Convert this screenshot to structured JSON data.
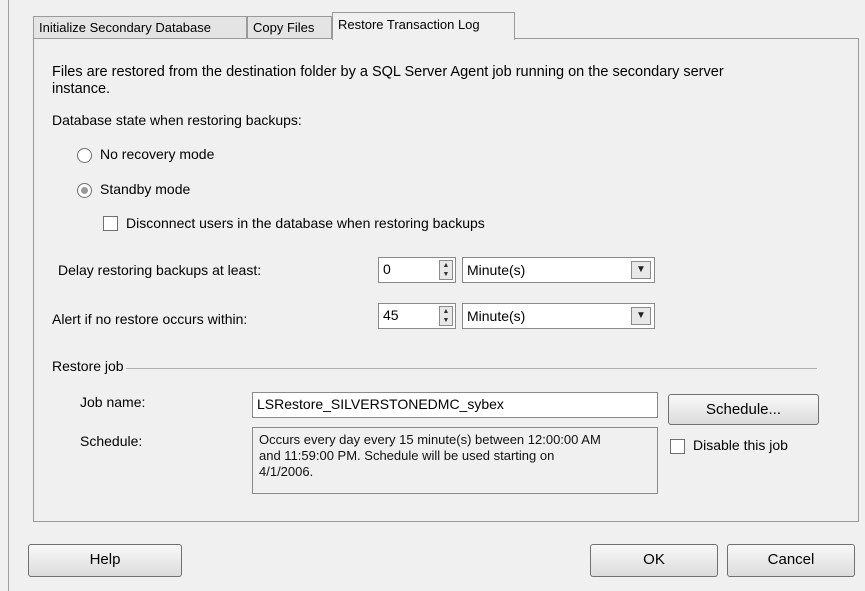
{
  "tabs": [
    {
      "label": "Initialize Secondary Database"
    },
    {
      "label": "Copy Files"
    },
    {
      "label": "Restore Transaction Log"
    }
  ],
  "intro_text_line1": "Files are restored from the destination folder by a SQL Server Agent job running on the secondary server",
  "intro_text_line2": "instance.",
  "db_state_label": "Database state when restoring backups:",
  "no_recovery_label": "No recovery mode",
  "standby_label": "Standby mode",
  "disconnect_label": "Disconnect users in the database when restoring backups",
  "delay_label": "Delay restoring backups at least:",
  "delay_value": "0",
  "delay_unit": "Minute(s)",
  "alert_label": "Alert if no restore occurs within:",
  "alert_value": "45",
  "alert_unit": "Minute(s)",
  "restore_job_label": "Restore job",
  "job_name_label": "Job name:",
  "job_name_value": "LSRestore_SILVERSTONEDMC_sybex",
  "schedule_label": "Schedule:",
  "schedule_text_line1": "Occurs every day every 15 minute(s) between 12:00:00 AM",
  "schedule_text_line2": "and 11:59:00 PM. Schedule will be used starting on",
  "schedule_text_line3": "4/1/2006.",
  "schedule_button": "Schedule...",
  "disable_job_label": "Disable this job",
  "help_button": "Help",
  "ok_button": "OK",
  "cancel_button": "Cancel",
  "state": {
    "standby_selected": true,
    "no_recovery_selected": false,
    "disconnect_checked": false,
    "disable_job_checked": false
  }
}
